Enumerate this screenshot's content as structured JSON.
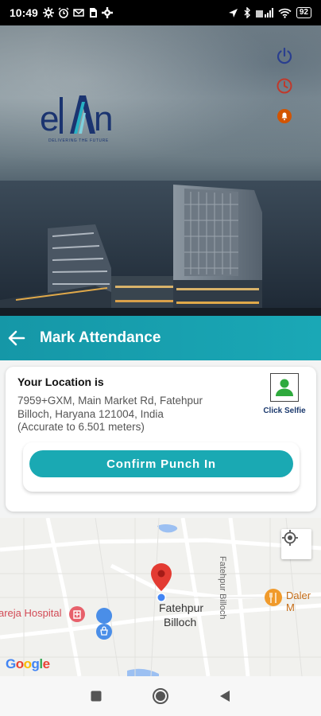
{
  "status_bar": {
    "time": "10:49",
    "battery": "92",
    "left_icons": [
      "settings-gear-icon",
      "alarm-icon",
      "mail-icon",
      "sim-icon",
      "gear-icon"
    ],
    "right_icons": [
      "location-arrow-icon",
      "bluetooth-icon",
      "signal-icon",
      "wifi-icon",
      "battery-icon"
    ]
  },
  "hero": {
    "logo_text": "elan",
    "logo_tagline": "DELIVERING THE FUTURE",
    "icons": [
      "power-icon",
      "history-clock-icon",
      "notification-icon"
    ],
    "icon_colors": {
      "power": "#2a3f8f",
      "clock": "#c0392b",
      "notification": "#d35400"
    }
  },
  "app_bar": {
    "title": "Mark Attendance",
    "color": "#1aa8b6"
  },
  "location_card": {
    "heading": "Your Location is",
    "address_line1": "7959+GXM, Main Market Rd, Fatehpur",
    "address_line2": "Billoch, Haryana 121004, India",
    "accuracy": "(Accurate to 6.501 meters)",
    "selfie_label": "Click Selfie",
    "confirm_button": "Confirm Punch In",
    "button_color": "#1aa9b3"
  },
  "map": {
    "town_line1": "Fatehpur",
    "town_line2": "Billoch",
    "hospital": "areja Hospital",
    "poi_right": "Daler M",
    "road": "Fatehpur Billoch",
    "google": "Google"
  },
  "nav_bar": {
    "buttons": [
      "recents-square-icon",
      "home-circle-icon",
      "back-triangle-icon"
    ]
  }
}
